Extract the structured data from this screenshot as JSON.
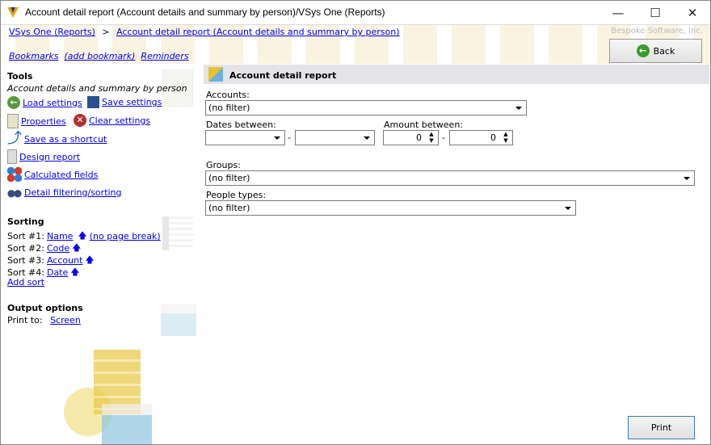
{
  "window": {
    "title": "Account detail report (Account details and summary by person)/VSys One (Reports)",
    "minimize": "—",
    "maximize": "☐",
    "close": "✕"
  },
  "breadcrumb": {
    "root": "VSys One (Reports)",
    "sep": ">",
    "current": "Account detail report (Account details and summary by person)"
  },
  "brand": "Bespoke Software, Inc.",
  "bookmarks": {
    "bookmarks": "Bookmarks",
    "add": "(add bookmark)",
    "reminders": "Reminders"
  },
  "back_label": "Back",
  "tools": {
    "heading": "Tools",
    "subtitle": "Account details and summary by person",
    "load": "Load settings",
    "save": "Save settings",
    "properties": "Properties",
    "clear": "Clear settings",
    "shortcut": "Save as a shortcut",
    "design": "Design report",
    "calc": "Calculated fields",
    "filter": "Detail filtering/sorting"
  },
  "sorting": {
    "heading": "Sorting",
    "sorts": [
      {
        "label": "Sort #1:",
        "field": "Name",
        "extra": "(no page break)"
      },
      {
        "label": "Sort #2:",
        "field": "Code"
      },
      {
        "label": "Sort #3:",
        "field": "Account"
      },
      {
        "label": "Sort #4:",
        "field": "Date"
      }
    ],
    "add": "Add sort"
  },
  "output": {
    "heading": "Output options",
    "print_to_label": "Print to:",
    "print_to": "Screen"
  },
  "form": {
    "title": "Account detail report",
    "accounts_label": "Accounts:",
    "accounts": "(no filter)",
    "dates_label": "Dates between:",
    "dash": "-",
    "amount_label": "Amount between:",
    "amount_from": "0",
    "amount_to": "0",
    "groups_label": "Groups:",
    "groups": "(no filter)",
    "people_label": "People types:",
    "people": "(no filter)"
  },
  "print_label": "Print"
}
